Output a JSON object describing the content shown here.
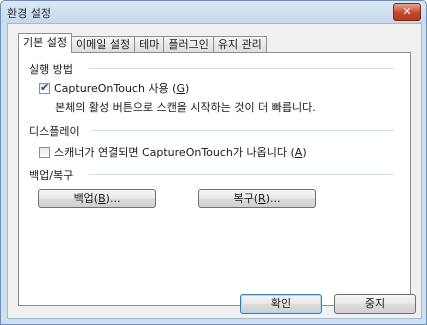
{
  "window": {
    "title": "환경 설정",
    "close_label": "✕"
  },
  "tabs": [
    {
      "label": "기본 설정",
      "active": true
    },
    {
      "label": "이메일 설정",
      "active": false
    },
    {
      "label": "테마",
      "active": false
    },
    {
      "label": "플러그인",
      "active": false
    },
    {
      "label": "유지 관리",
      "active": false
    }
  ],
  "groups": {
    "run_method": {
      "title": "실행 방법",
      "checkbox_prefix": "CaptureOnTouch 사용 (",
      "checkbox_hotkey": "G",
      "checkbox_suffix": ")",
      "checked": true,
      "description": "본체의 활성 버튼으로 스캔을 시작하는 것이 더 빠릅니다."
    },
    "display": {
      "title": "디스플레이",
      "checkbox_prefix": "스캐너가 연결되면 CaptureOnTouch가 나옵니다 (",
      "checkbox_hotkey": "A",
      "checkbox_suffix": ")",
      "checked": false
    },
    "backup": {
      "title": "백업/복구",
      "backup_prefix": "백업(",
      "backup_hotkey": "B",
      "backup_suffix": ")...",
      "restore_prefix": "복구(",
      "restore_hotkey": "R",
      "restore_suffix": ")..."
    }
  },
  "footer": {
    "ok_label": "확인",
    "cancel_label": "중지"
  }
}
